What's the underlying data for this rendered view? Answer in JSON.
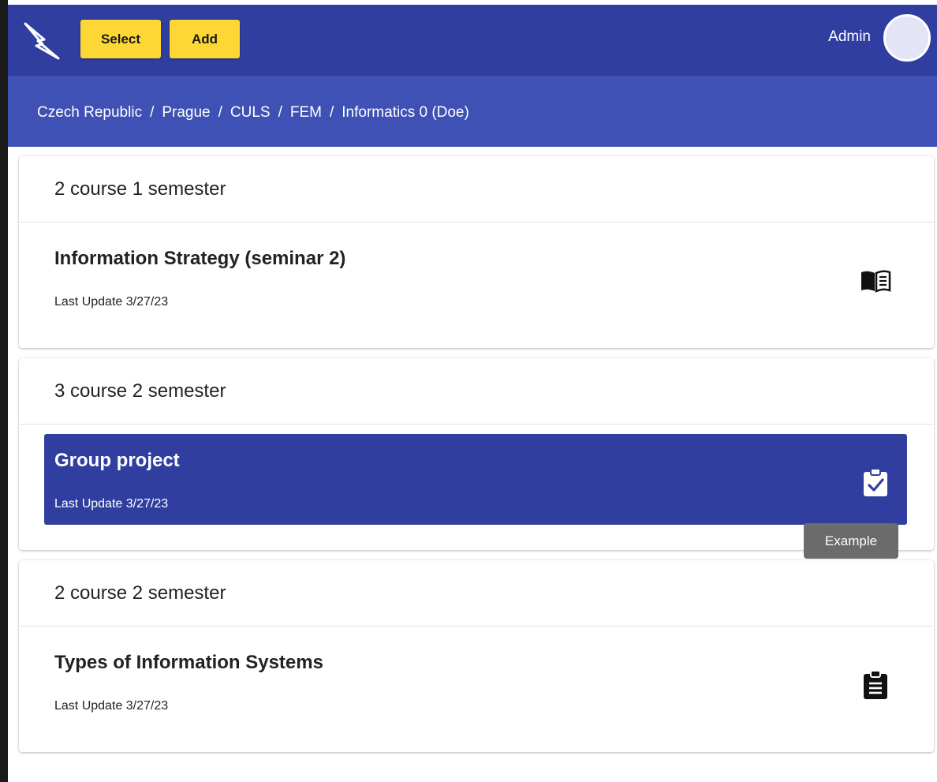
{
  "header": {
    "logo": "lightning-logo",
    "select_label": "Select",
    "add_label": "Add",
    "user_name": "Admin",
    "brand_color": "#303f9f",
    "accent_color": "#fdd835"
  },
  "breadcrumb": [
    "Czech Republic",
    "Prague",
    "CULS",
    "FEM",
    "Informatics 0 (Doe)"
  ],
  "groups": [
    {
      "title": "2 course 1 semester",
      "items": [
        {
          "title": "Information Strategy (seminar 2)",
          "updated": "Last Update 3/27/23",
          "icon": "book-icon",
          "selected": false
        }
      ]
    },
    {
      "title": "3 course 2 semester",
      "items": [
        {
          "title": "Group project",
          "updated": "Last Update 3/27/23",
          "icon": "clipboard-check-icon",
          "selected": true
        }
      ]
    },
    {
      "title": "2 course 2 semester",
      "items": [
        {
          "title": "Types of Information Systems",
          "updated": "Last Update 3/27/23",
          "icon": "clipboard-list-icon",
          "selected": false
        }
      ]
    }
  ],
  "tooltip": "Example"
}
